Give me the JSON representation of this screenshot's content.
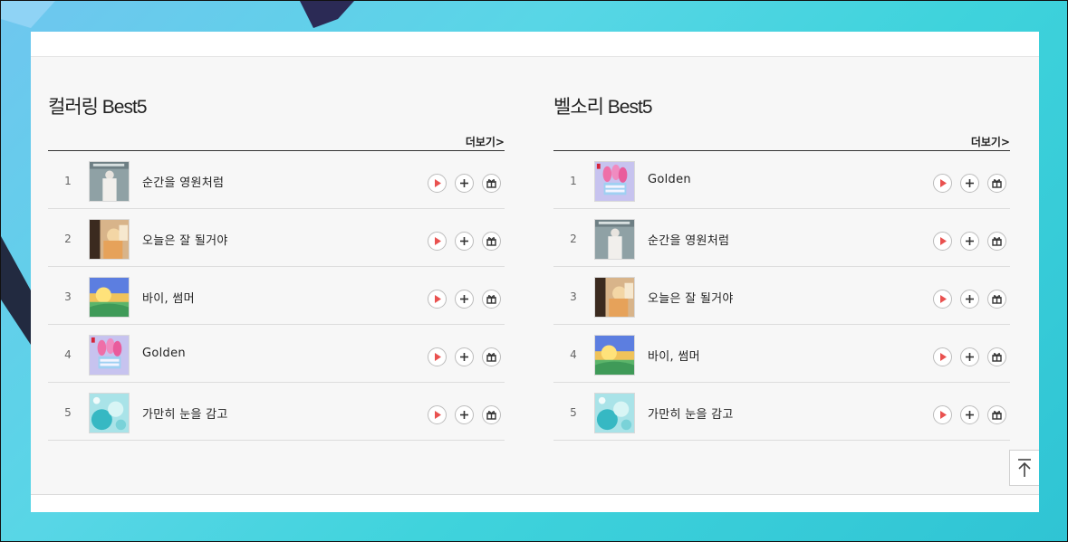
{
  "sections": [
    {
      "title": "컬러링 Best5",
      "more_label": "더보기>",
      "items": [
        {
          "rank": "1",
          "title": "순간을 영원처럼",
          "art": "a"
        },
        {
          "rank": "2",
          "title": "오늘은 잘 될거야",
          "art": "b"
        },
        {
          "rank": "3",
          "title": "바이, 썸머",
          "art": "c"
        },
        {
          "rank": "4",
          "title": "Golden",
          "art": "d"
        },
        {
          "rank": "5",
          "title": "가만히 눈을 감고",
          "art": "e"
        }
      ]
    },
    {
      "title": "벨소리 Best5",
      "more_label": "더보기>",
      "items": [
        {
          "rank": "1",
          "title": "Golden",
          "art": "d"
        },
        {
          "rank": "2",
          "title": "순간을 영원처럼",
          "art": "a"
        },
        {
          "rank": "3",
          "title": "오늘은 잘 될거야",
          "art": "b"
        },
        {
          "rank": "4",
          "title": "바이, 썸머",
          "art": "c"
        },
        {
          "rank": "5",
          "title": "가만히 눈을 감고",
          "art": "e"
        }
      ]
    }
  ],
  "icons": {
    "play": "play-icon",
    "add": "plus-icon",
    "gift": "gift-icon",
    "scroll_top": "arrow-up-to-top-icon"
  },
  "colors": {
    "play_accent": "#e9514f",
    "divider": "#333333"
  }
}
